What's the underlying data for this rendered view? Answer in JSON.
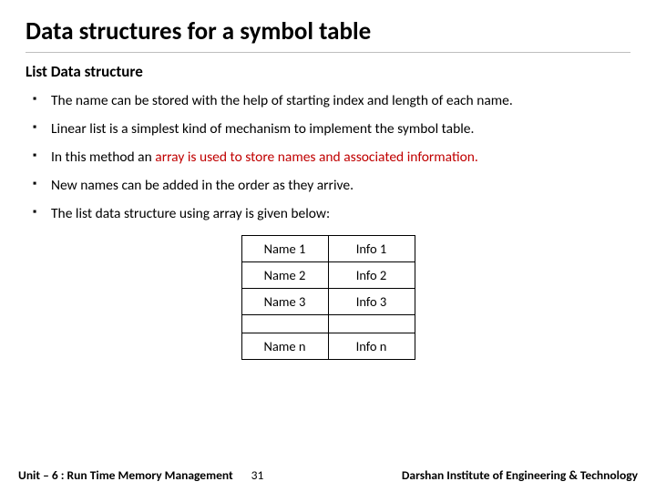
{
  "title": "Data structures for a symbol table",
  "subtitle": "List Data structure",
  "bullets": {
    "b0": "The name can be stored with the help of starting index and length of each name.",
    "b1": "Linear list is a simplest kind of mechanism to implement the symbol table.",
    "b2_pre": "In this method an ",
    "b2_hl": "array is used to store names and associated information.",
    "b3": "New names can be added in the order as they arrive.",
    "b4": "The list data structure using array is given below:"
  },
  "table": {
    "r0c0": "Name 1",
    "r0c1": "Info 1",
    "r1c0": "Name 2",
    "r1c1": "Info 2",
    "r2c0": "Name 3",
    "r2c1": "Info 3",
    "r3c0": "Name n",
    "r3c1": "Info n"
  },
  "footer": {
    "unit": "Unit – 6 : Run Time Memory Management",
    "page": "31",
    "institute": "Darshan Institute of Engineering & Technology"
  }
}
